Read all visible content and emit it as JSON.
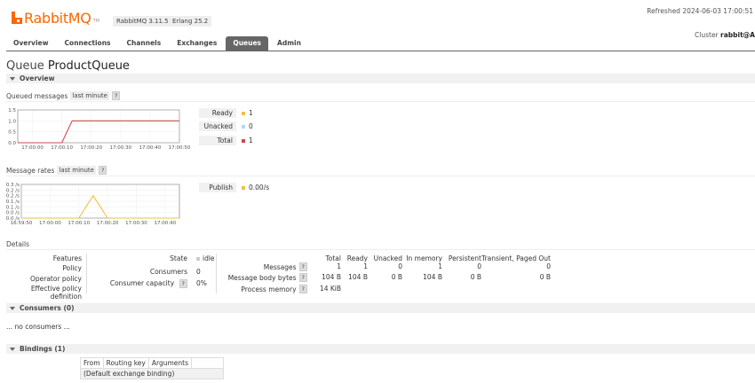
{
  "header": {
    "brand_name": "RabbitMQ",
    "brand_tm": "TM",
    "version": "RabbitMQ 3.11.5",
    "erlang": "Erlang 25.2",
    "refreshed": "Refreshed 2024-06-03 17:00:51",
    "cluster_label": "Cluster",
    "cluster_name": "rabbit@A"
  },
  "tabs": [
    {
      "label": "Overview"
    },
    {
      "label": "Connections"
    },
    {
      "label": "Channels"
    },
    {
      "label": "Exchanges"
    },
    {
      "label": "Queues",
      "active": true
    },
    {
      "label": "Admin"
    }
  ],
  "page": {
    "title_prefix": "Queue",
    "title_name": "ProductQueue"
  },
  "sections": {
    "overview": "Overview",
    "consumers": "Consumers (0)",
    "bindings": "Bindings (1)"
  },
  "queued": {
    "label": "Queued messages",
    "range": "last minute",
    "help": "?"
  },
  "rates": {
    "label": "Message rates",
    "range": "last minute",
    "help": "?"
  },
  "colors": {
    "ready": "#edc240",
    "unacked": "#afd8f8",
    "total": "#cb4b4b",
    "publish": "#edc240",
    "accent": "#ff6600"
  },
  "legend_queued": [
    {
      "label": "Ready",
      "value": "1",
      "color": "#edc240"
    },
    {
      "label": "Unacked",
      "value": "0",
      "color": "#afd8f8"
    },
    {
      "label": "Total",
      "value": "1",
      "color": "#cb4b4b"
    }
  ],
  "legend_rates": [
    {
      "label": "Publish",
      "value": "0.00/s",
      "color": "#edc240"
    }
  ],
  "chart_data": [
    {
      "type": "line",
      "ylim": [
        0,
        1.5
      ],
      "yticks": [
        "1.5",
        "1.0",
        "0.5",
        "0.0"
      ],
      "xticks": [
        "17:00:00",
        "17:00:10",
        "17:00:20",
        "17:00:30",
        "17:00:40",
        "17:00:50"
      ],
      "x": [
        -5,
        0,
        10,
        13.5,
        20,
        30,
        40,
        50
      ],
      "series": [
        {
          "name": "Total",
          "values": [
            0,
            0,
            0,
            1,
            1,
            1,
            1,
            1
          ]
        }
      ],
      "xlim": [
        -5,
        50
      ],
      "grid": true
    },
    {
      "type": "line",
      "ylim": [
        0,
        0.3
      ],
      "yticks": [
        "0.3 /s",
        "0.2 /s",
        "0.2 /s",
        "0.1 /s",
        "0.1 /s",
        "0.0 /s",
        "0.0 /s"
      ],
      "xticks": [
        "16:59:50",
        "17:00:00",
        "17:00:10",
        "17:00:20",
        "17:00:30",
        "17:00:40"
      ],
      "x": [
        -10,
        5,
        10,
        15,
        20,
        40,
        45
      ],
      "series": [
        {
          "name": "Publish",
          "values": [
            0,
            0,
            0,
            0.2,
            0,
            0,
            0
          ]
        }
      ],
      "xlim": [
        -10,
        45
      ],
      "grid": true
    }
  ],
  "details": {
    "title": "Details",
    "left_labels": [
      "Features",
      "Policy",
      "Operator policy",
      "Effective policy definition"
    ],
    "state_label": "State",
    "state_value": "idle",
    "consumers_label": "Consumers",
    "consumers_value": "0",
    "capacity_label": "Consumer capacity",
    "capacity_value": "0%",
    "help": "?",
    "stats_headers": [
      "Total",
      "Ready",
      "Unacked",
      "In memory",
      "Persistent",
      "Transient, Paged Out"
    ],
    "stats_rows": [
      {
        "label": "Messages",
        "values": [
          "1",
          "1",
          "0",
          "1",
          "0",
          "0"
        ]
      },
      {
        "label": "Message body bytes",
        "values": [
          "104 B",
          "104 B",
          "0 B",
          "104 B",
          "0 B",
          "0 B"
        ]
      },
      {
        "label": "Process memory",
        "values": [
          "14 KiB"
        ]
      }
    ]
  },
  "consumers": {
    "empty": "... no consumers ..."
  },
  "bindings": {
    "headers": [
      "From",
      "Routing key",
      "Arguments",
      ""
    ],
    "rows": [
      [
        "(Default exchange binding)"
      ]
    ]
  }
}
